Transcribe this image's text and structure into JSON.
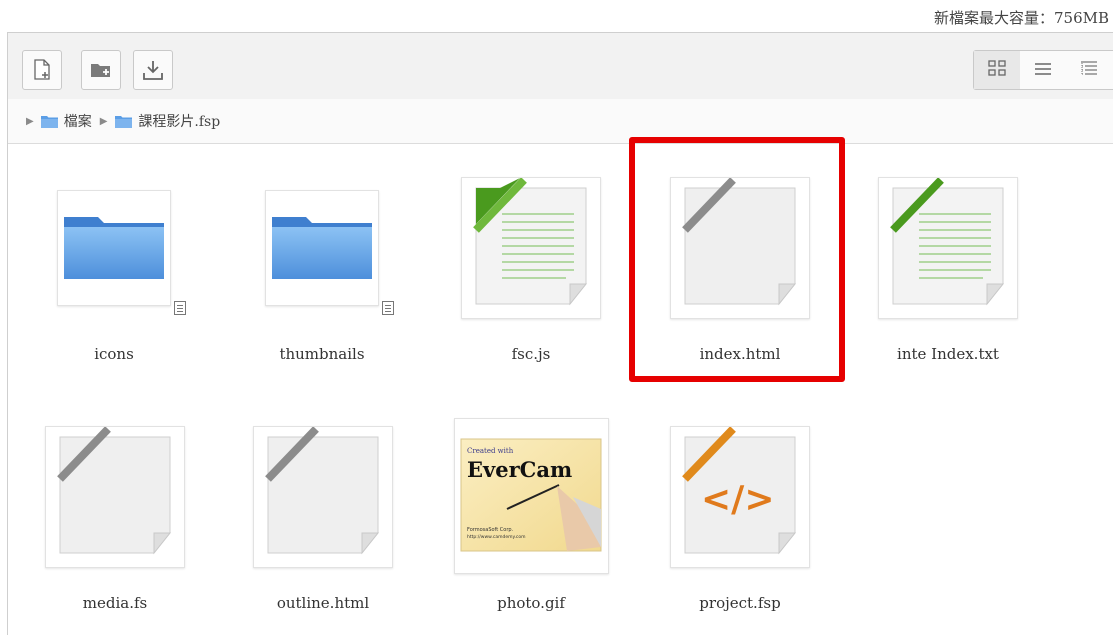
{
  "quota": {
    "text": "新檔案最大容量：756MB"
  },
  "toolbar": {
    "buttons": [
      {
        "icon": "new-file-icon"
      },
      {
        "icon": "new-folder-icon"
      },
      {
        "icon": "download-icon"
      }
    ],
    "views": [
      {
        "icon": "grid-view-icon",
        "active": true
      },
      {
        "icon": "list-view-icon",
        "active": false
      },
      {
        "icon": "tree-view-icon",
        "active": false
      }
    ]
  },
  "breadcrumb": [
    "檔案",
    "課程影片.fsp"
  ],
  "files": [
    {
      "name": "icons",
      "type": "folder"
    },
    {
      "name": "thumbnails",
      "type": "folder"
    },
    {
      "name": "fsc.js",
      "type": "text"
    },
    {
      "name": "index.html",
      "type": "blank",
      "selected": true
    },
    {
      "name": "inte Index.txt",
      "type": "text"
    },
    {
      "name": "media.fs",
      "type": "blank"
    },
    {
      "name": "outline.html",
      "type": "blank"
    },
    {
      "name": "photo.gif",
      "type": "image",
      "image_text": [
        "Created with",
        "EverCam",
        "FormosaSoft Corp.",
        "http://www.camdemy.com"
      ]
    },
    {
      "name": "project.fsp",
      "type": "code",
      "glyph": "</>"
    }
  ],
  "colors": {
    "highlight": "#e60000",
    "folder": "#5b9ee6",
    "text_ribbon": "#4a9a1e",
    "code_ribbon": "#e08a1c",
    "code_glyph": "#e07a1c"
  }
}
